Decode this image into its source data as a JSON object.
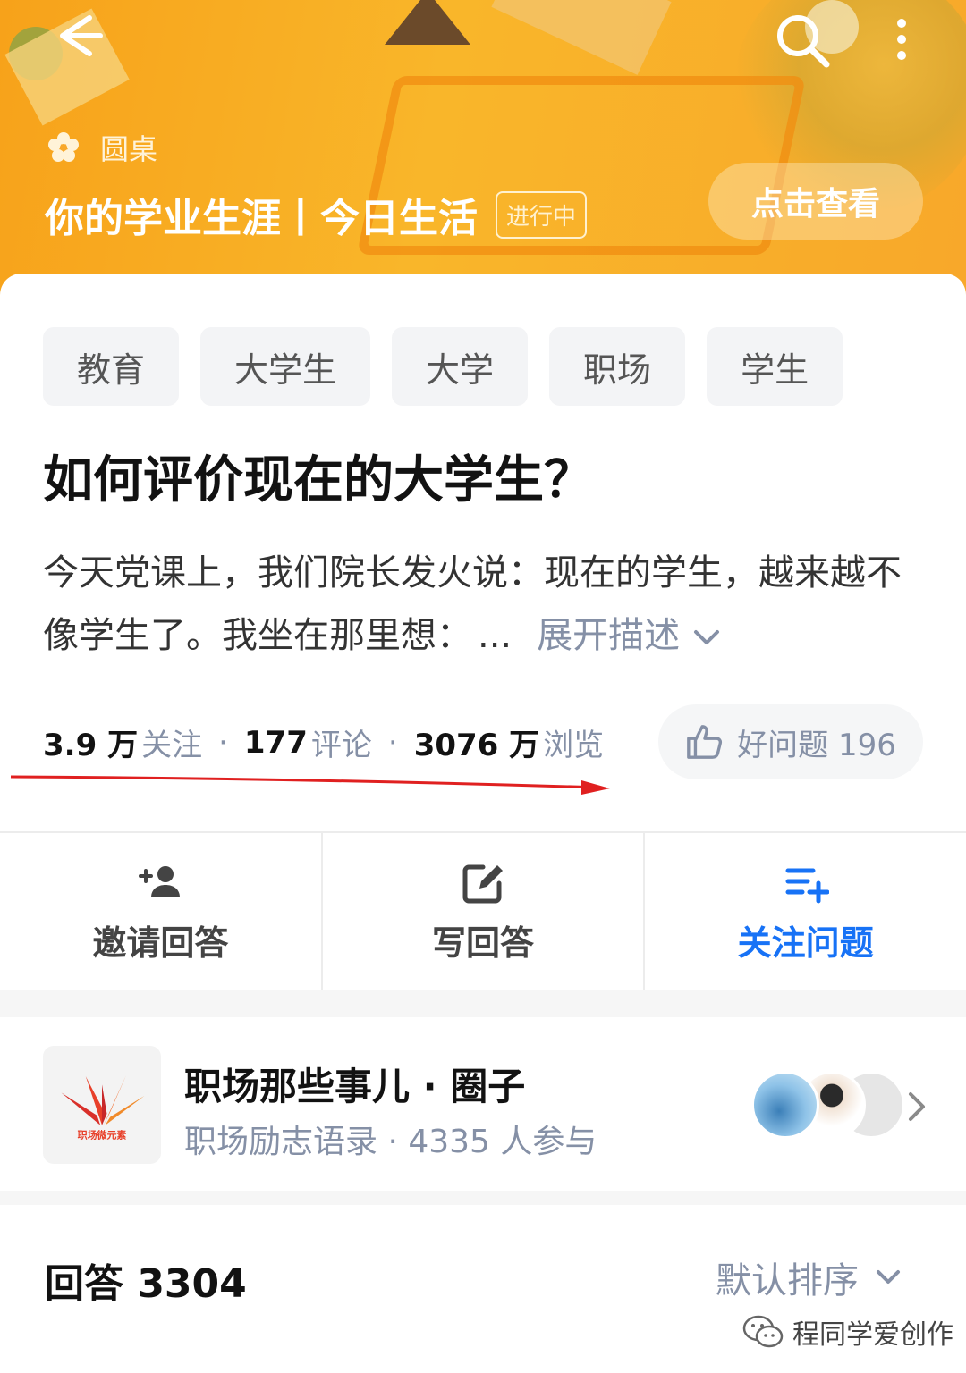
{
  "banner": {
    "roundtable_label": "圆桌",
    "title": "你的学业生涯丨今日生活",
    "status_badge": "进行中",
    "view_button": "点击查看"
  },
  "question": {
    "tags": [
      "教育",
      "大学生",
      "大学",
      "职场",
      "学生"
    ],
    "title": "如何评价现在的大学生？",
    "description": "今天党课上，我们院长发火说：现在的学生，越来越不像学生了。我坐在那里想：",
    "ellipsis": "...",
    "expand_label": "展开描述",
    "stats": {
      "followers_value": "3.9 万",
      "followers_label": "关注",
      "comments_value": "177",
      "comments_label": "评论",
      "views_value": "3076 万",
      "views_label": "浏览",
      "separator": "·"
    },
    "good_question": "好问题 196"
  },
  "actions": {
    "invite": "邀请回答",
    "write": "写回答",
    "follow": "关注问题"
  },
  "circle": {
    "logo_text": "职场微元素",
    "name": "职场那些事儿 · 圈子",
    "subtitle": "职场励志语录 · 4335 人参与"
  },
  "answers": {
    "count_label": "回答 3304",
    "sort_label": "默认排序"
  },
  "watermark": "程同学爱创作",
  "colors": {
    "banner": "#f8a82a",
    "accent_blue": "#1772f6",
    "muted": "#8590a6",
    "annotation_red": "#e02020"
  }
}
